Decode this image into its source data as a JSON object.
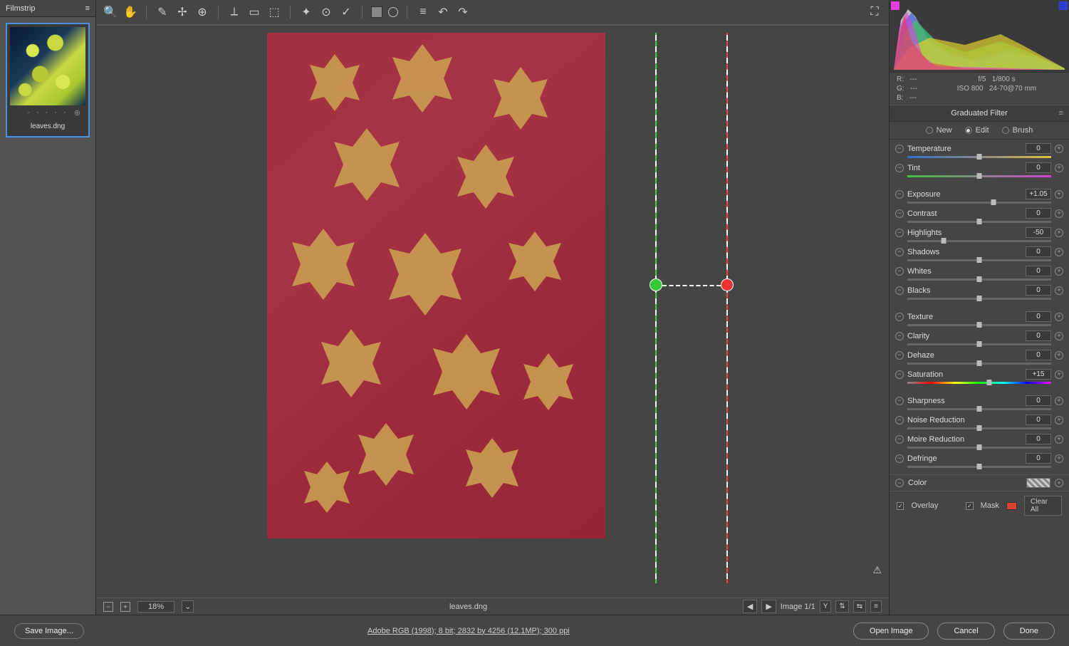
{
  "filmstrip": {
    "title": "Filmstrip",
    "thumbName": "leaves.dng"
  },
  "toolbar": {
    "icons": [
      "zoom",
      "hand",
      "whitebalance",
      "color-sampler",
      "target-adj",
      "crop",
      "straighten",
      "spot",
      "redeye",
      "mask-brush",
      "grad-filter",
      "radial-filter",
      "adjust-brush"
    ],
    "swatch": "#808080"
  },
  "histogram": {
    "rgb": {
      "R": "---",
      "G": "---",
      "B": "---"
    },
    "exif": {
      "aperture": "f/5",
      "shutter": "1/800 s",
      "iso": "ISO 800",
      "lens": "24-70@70 mm"
    }
  },
  "panel": {
    "title": "Graduated Filter",
    "modes": {
      "new": "New",
      "edit": "Edit",
      "brush": "Brush",
      "selected": "edit"
    }
  },
  "sliders": [
    {
      "group": 1,
      "name": "Temperature",
      "value": "0",
      "pos": 50,
      "grad": "temp"
    },
    {
      "group": 1,
      "name": "Tint",
      "value": "0",
      "pos": 50,
      "grad": "tint"
    },
    {
      "group": 2,
      "name": "Exposure",
      "value": "+1.05",
      "pos": 60
    },
    {
      "group": 2,
      "name": "Contrast",
      "value": "0",
      "pos": 50
    },
    {
      "group": 2,
      "name": "Highlights",
      "value": "-50",
      "pos": 25
    },
    {
      "group": 2,
      "name": "Shadows",
      "value": "0",
      "pos": 50
    },
    {
      "group": 2,
      "name": "Whites",
      "value": "0",
      "pos": 50
    },
    {
      "group": 2,
      "name": "Blacks",
      "value": "0",
      "pos": 50
    },
    {
      "group": 3,
      "name": "Texture",
      "value": "0",
      "pos": 50
    },
    {
      "group": 3,
      "name": "Clarity",
      "value": "0",
      "pos": 50
    },
    {
      "group": 3,
      "name": "Dehaze",
      "value": "0",
      "pos": 50
    },
    {
      "group": 3,
      "name": "Saturation",
      "value": "+15",
      "pos": 57,
      "grad": "sat"
    },
    {
      "group": 4,
      "name": "Sharpness",
      "value": "0",
      "pos": 50
    },
    {
      "group": 4,
      "name": "Noise Reduction",
      "value": "0",
      "pos": 50
    },
    {
      "group": 4,
      "name": "Moire Reduction",
      "value": "0",
      "pos": 50
    },
    {
      "group": 4,
      "name": "Defringe",
      "value": "0",
      "pos": 50
    }
  ],
  "colorRow": {
    "label": "Color"
  },
  "options": {
    "overlay": "Overlay",
    "mask": "Mask",
    "clearAll": "Clear All"
  },
  "status": {
    "zoom": "18%",
    "filename": "leaves.dng",
    "imageCount": "Image 1/1"
  },
  "footer": {
    "save": "Save Image...",
    "info": "Adobe RGB (1998); 8 bit; 2832 by 4256 (12.1MP); 300 ppi",
    "open": "Open Image",
    "cancel": "Cancel",
    "done": "Done"
  }
}
